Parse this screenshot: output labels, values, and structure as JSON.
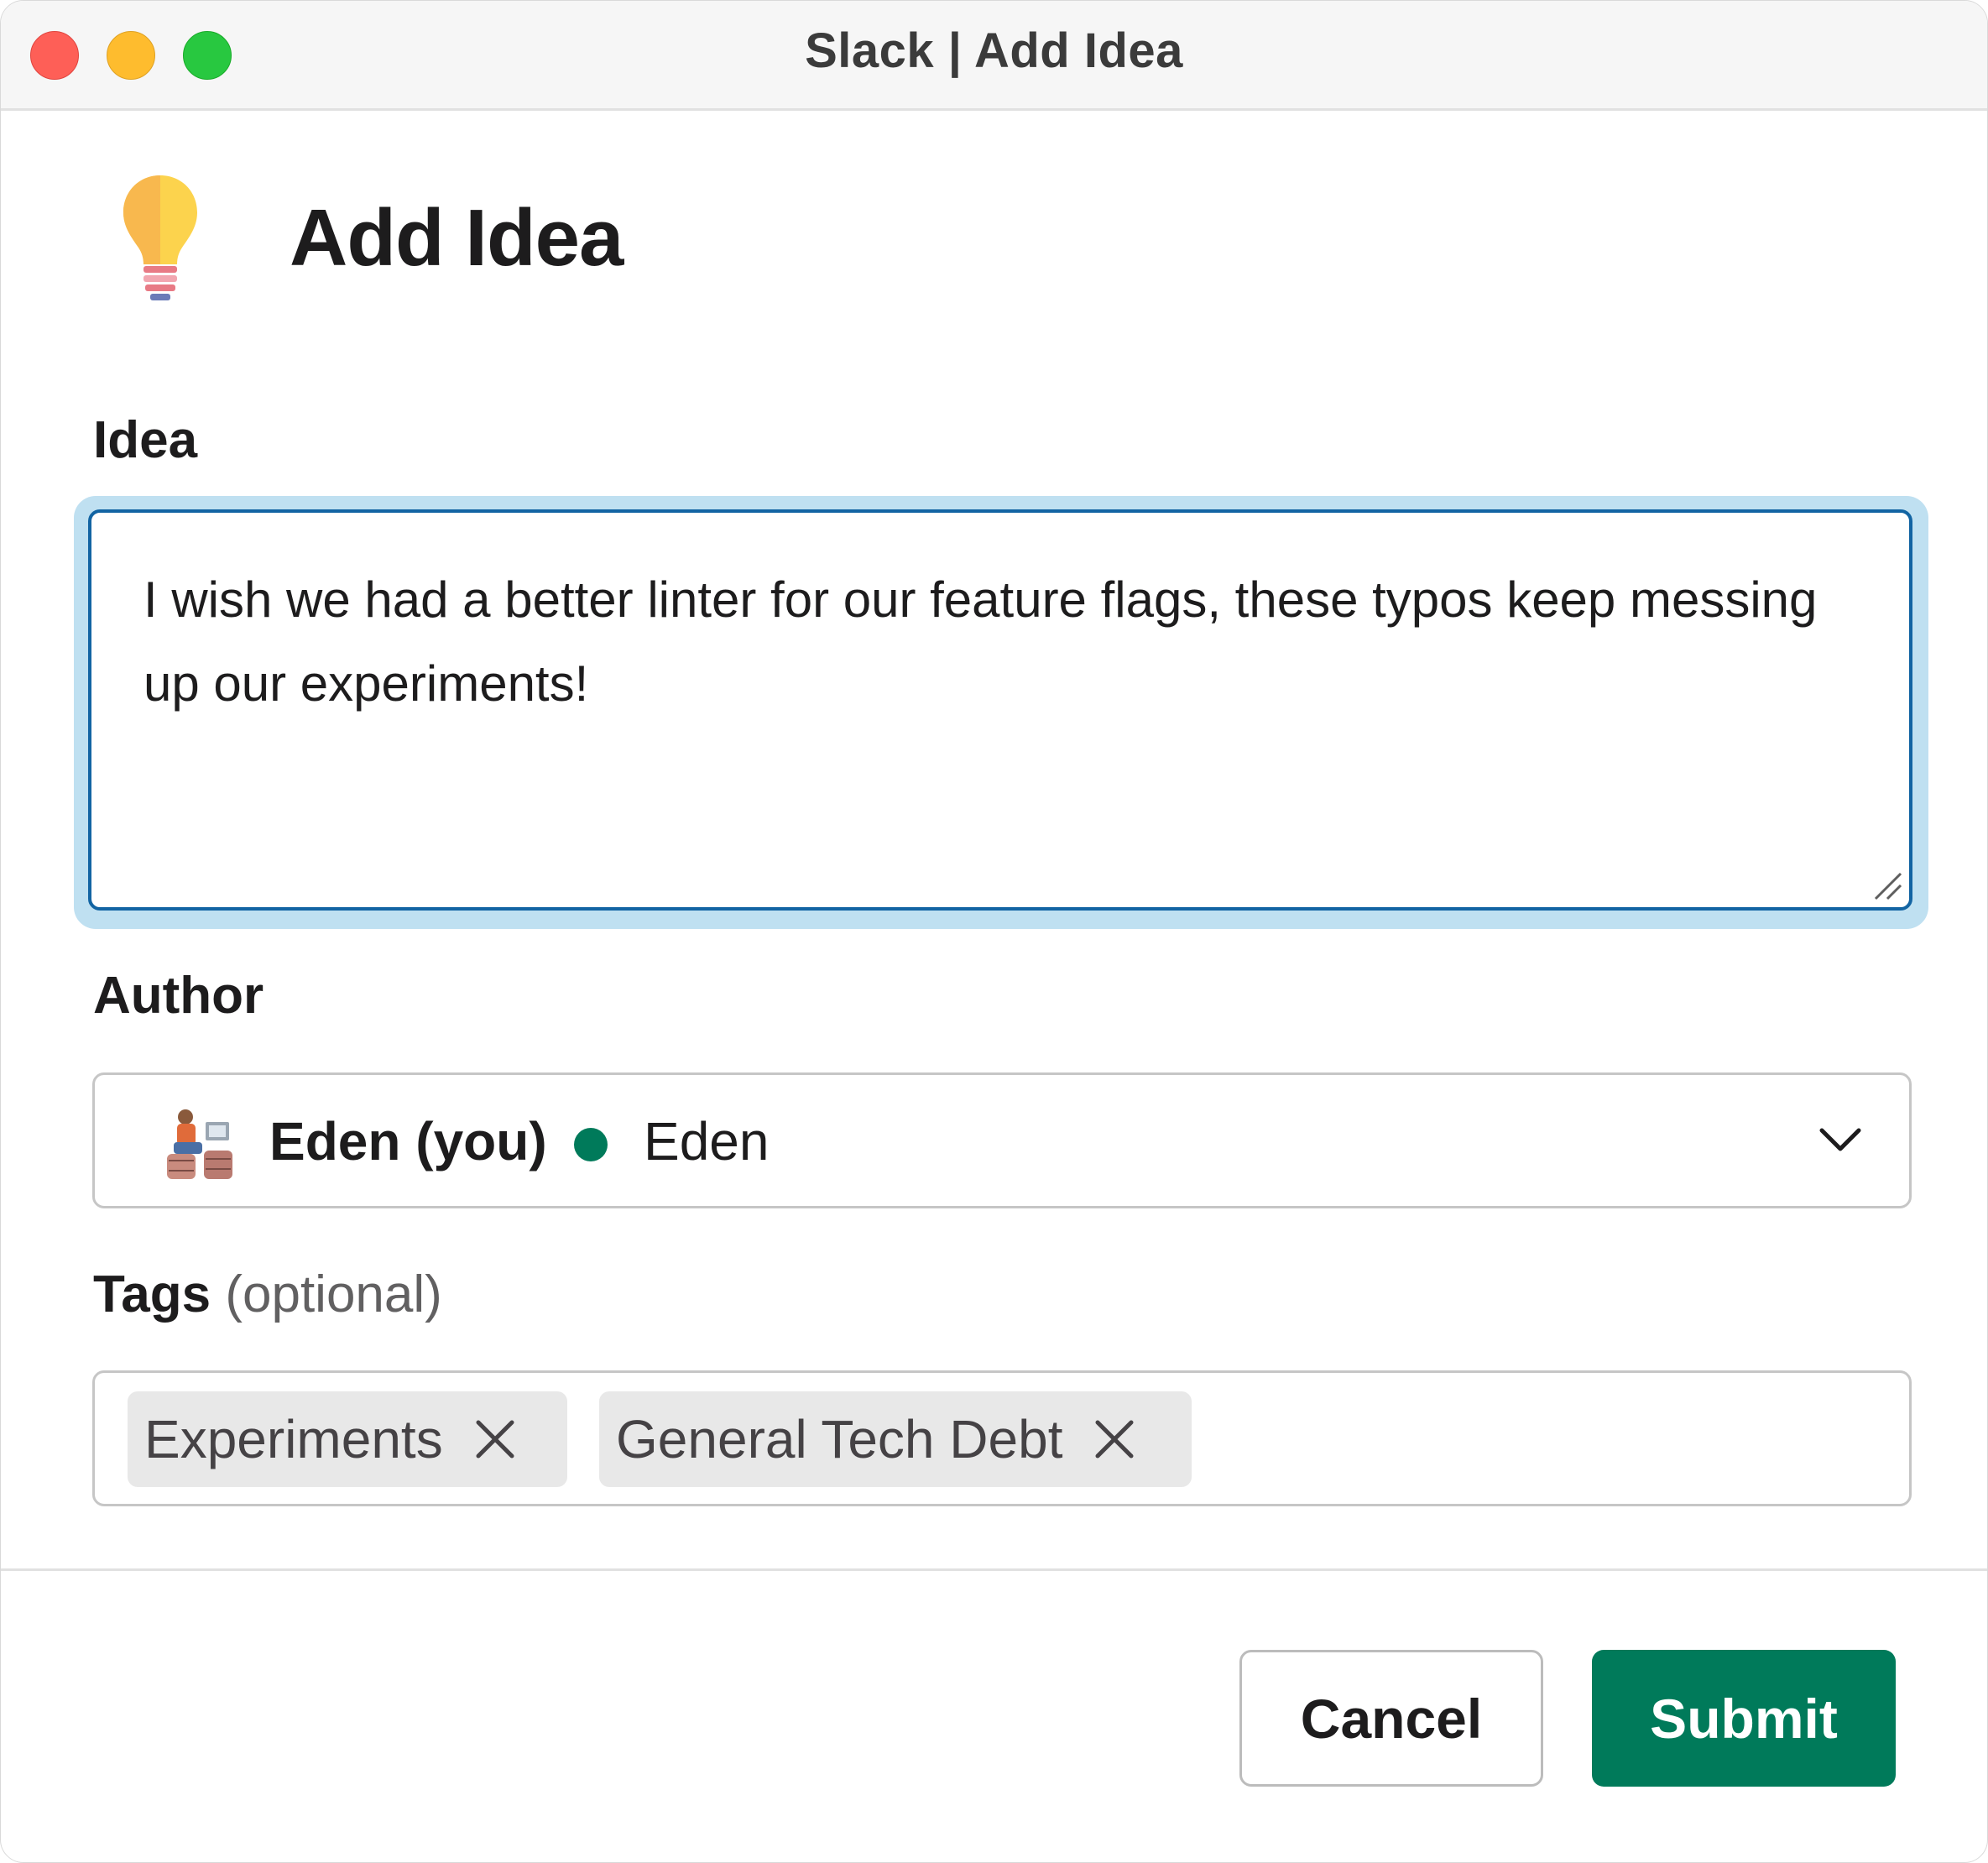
{
  "window": {
    "title": "Slack | Add Idea"
  },
  "header": {
    "icon": "lightbulb-icon",
    "title": "Add Idea"
  },
  "idea": {
    "label": "Idea",
    "value": "I wish we had a better linter for our feature flags, these typos keep messing up our experiments!"
  },
  "author": {
    "label": "Author",
    "selected_name": "Eden (you)",
    "handle": "Eden",
    "presence": "active",
    "presence_color": "#007a5a"
  },
  "tags": {
    "label": "Tags",
    "optional_text": "(optional)",
    "items": [
      {
        "label": "Experiments"
      },
      {
        "label": "General Tech Debt"
      }
    ]
  },
  "footer": {
    "cancel_label": "Cancel",
    "submit_label": "Submit",
    "submit_color": "#007a5a"
  }
}
